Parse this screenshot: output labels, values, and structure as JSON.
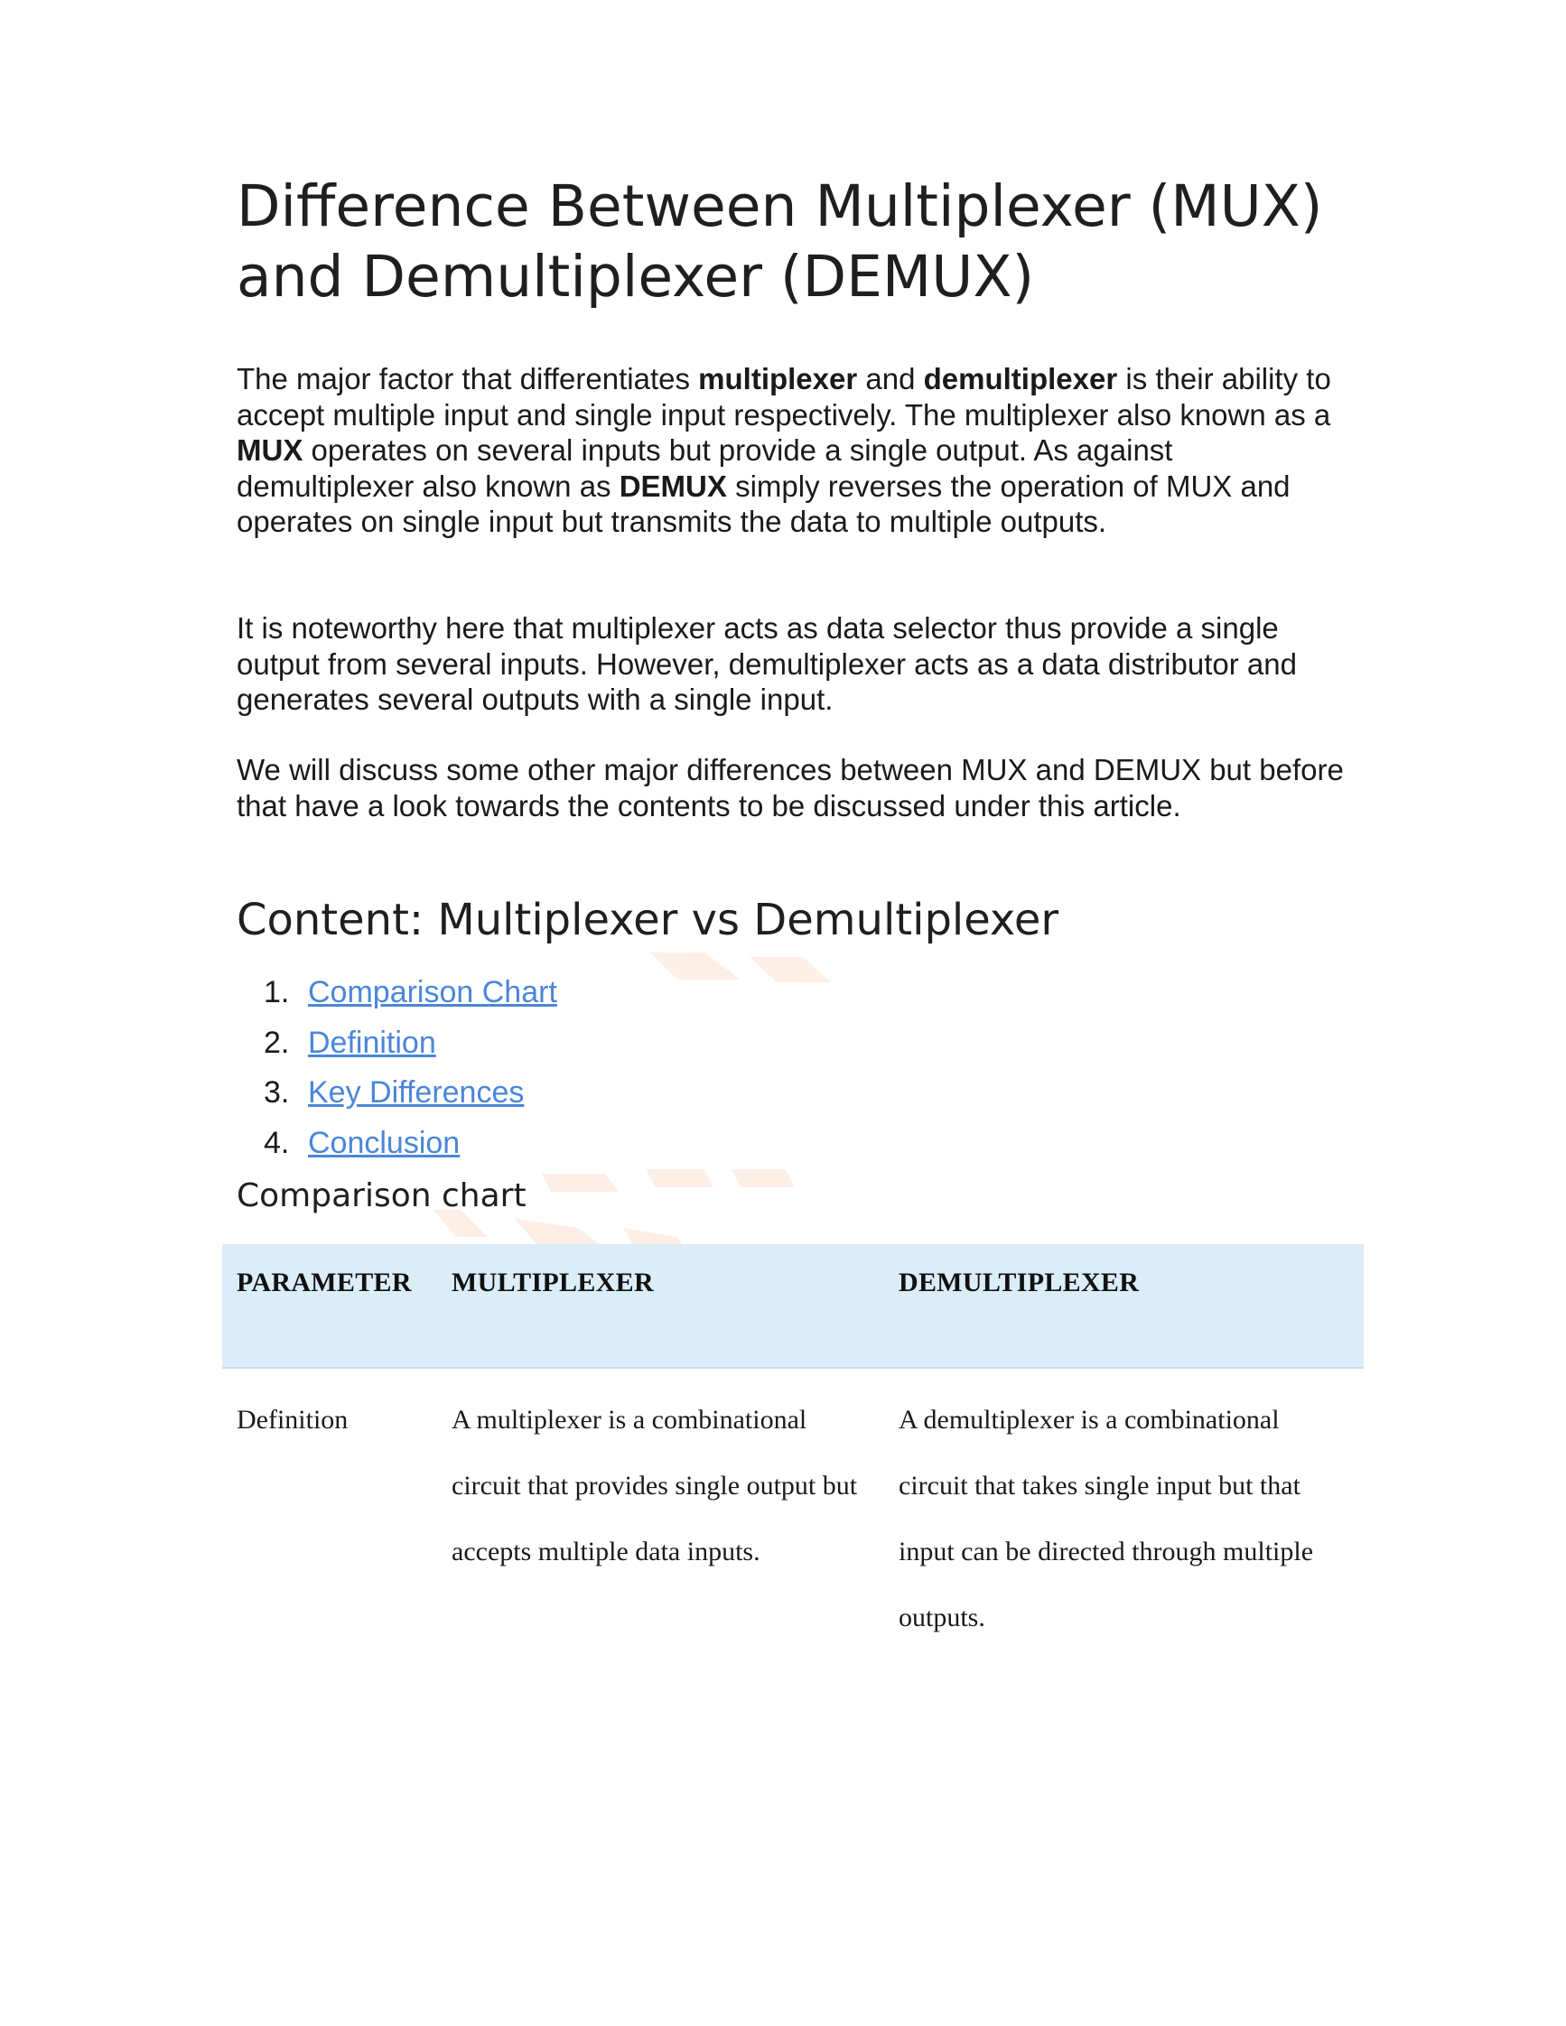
{
  "title": "Difference Between Multiplexer (MUX) and Demultiplexer (DEMUX)",
  "intro": {
    "t1": "The major factor that differentiates ",
    "b1": "multiplexer",
    "t2": " and ",
    "b2": "demultiplexer",
    "t3": " is their ability to accept multiple input and single input respectively. The multiplexer also known as a ",
    "b3": "MUX",
    "t4": " operates on several inputs but provide a single output. As against demultiplexer also known as ",
    "b4": "DEMUX",
    "t5": " simply reverses the operation of MUX and operates on single input but transmits the data to multiple outputs."
  },
  "para2": "It is noteworthy here that multiplexer acts as data selector thus provide a single output from several inputs. However, demultiplexer acts as a data distributor and generates several outputs with a single input.",
  "para3": "We will discuss some other major differences between MUX and DEMUX but before that have a look towards the contents to be discussed under this article.",
  "content_heading": "Content: Multiplexer vs Demultiplexer",
  "toc": [
    {
      "num": "1.",
      "label": "Comparison Chart"
    },
    {
      "num": "2.",
      "label": "Definition"
    },
    {
      "num": "3.",
      "label": "Key Differences"
    },
    {
      "num": "4.",
      "label": "Conclusion"
    }
  ],
  "comparison_heading": "Comparison chart",
  "table": {
    "headers": [
      "PARAMETER",
      "MULTIPLEXER",
      "DEMULTIPLEXER"
    ],
    "rows": [
      {
        "parameter": "Definition",
        "multiplexer": "A multiplexer is a combinational circuit that provides single output but accepts multiple data inputs.",
        "demultiplexer": "A demultiplexer is a combinational circuit that takes single input but that input can be directed through multiple outputs."
      }
    ]
  },
  "colors": {
    "link": "#4a86d8",
    "table_header_bg": "#dbedf9",
    "watermark": "#f5a26a"
  }
}
